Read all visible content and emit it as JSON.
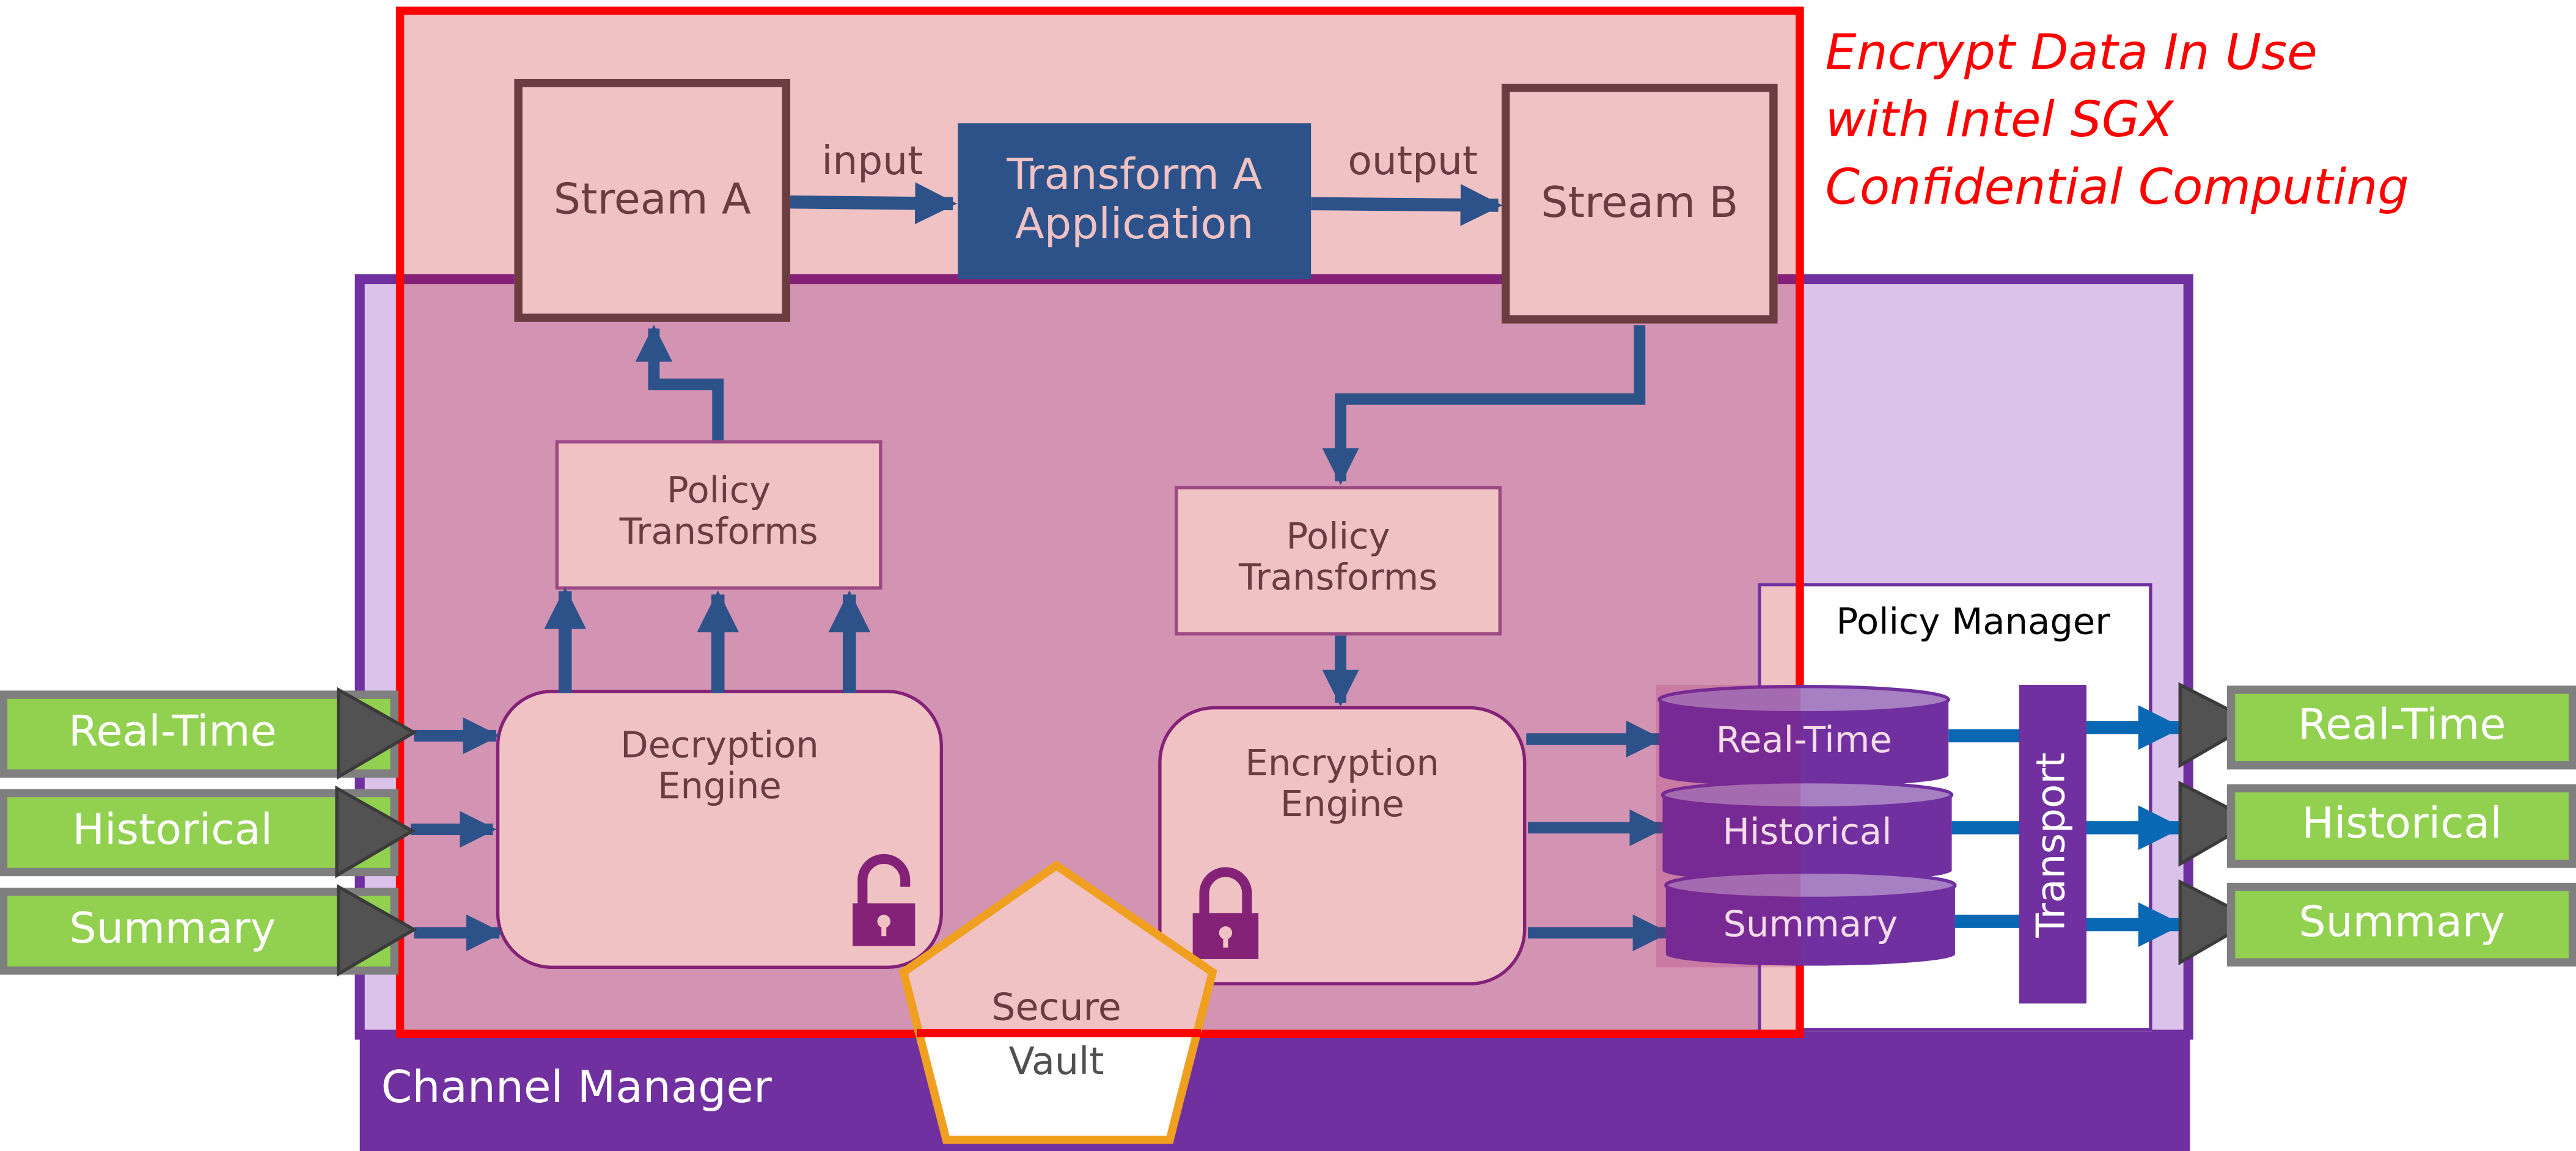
{
  "title": {
    "lines": [
      "Encrypt Data In Use",
      "with Intel SGX",
      "Confidential Computing"
    ]
  },
  "colors": {
    "enclave_border": "#ff0000",
    "enclave_fill": "#f0c2c4",
    "channel_manager": "#7030a0",
    "channel_inner": "#dbc2ea",
    "overlap_fill": "#d393b3",
    "flow_arrow": "#2d528a",
    "transport_arrow": "#0868b4",
    "stream_border": "#6b3c40",
    "app_fill": "#2d528a",
    "engine_border": "#832277",
    "db_fill": "#7030a0",
    "io_fill": "#92d050",
    "io_border": "#7f7f7f",
    "io_triangle": "#525252",
    "vault_border": "#f0a020",
    "label_dark": "#6b3c40"
  },
  "top_flow": {
    "stream_a": "Stream A",
    "input_label": "input",
    "app_line1": "Transform A",
    "app_line2": "Application",
    "output_label": "output",
    "stream_b": "Stream B"
  },
  "policy_transforms_left": {
    "line1": "Policy",
    "line2": "Transforms"
  },
  "policy_transforms_right": {
    "line1": "Policy",
    "line2": "Transforms"
  },
  "decryption_engine": {
    "line1": "Decryption",
    "line2": "Engine",
    "icon": "unlocked-padlock-icon"
  },
  "encryption_engine": {
    "line1": "Encryption",
    "line2": "Engine",
    "icon": "locked-padlock-icon"
  },
  "secure_vault": {
    "line1": "Secure",
    "line2": "Vault"
  },
  "channel_manager": {
    "label": "Channel Manager"
  },
  "policy_manager": {
    "label": "Policy Manager"
  },
  "transport": {
    "label": "Transport"
  },
  "databases": [
    "Real-Time",
    "Historical",
    "Summary"
  ],
  "inputs": [
    "Real-Time",
    "Historical",
    "Summary"
  ],
  "outputs": [
    "Real-Time",
    "Historical",
    "Summary"
  ]
}
